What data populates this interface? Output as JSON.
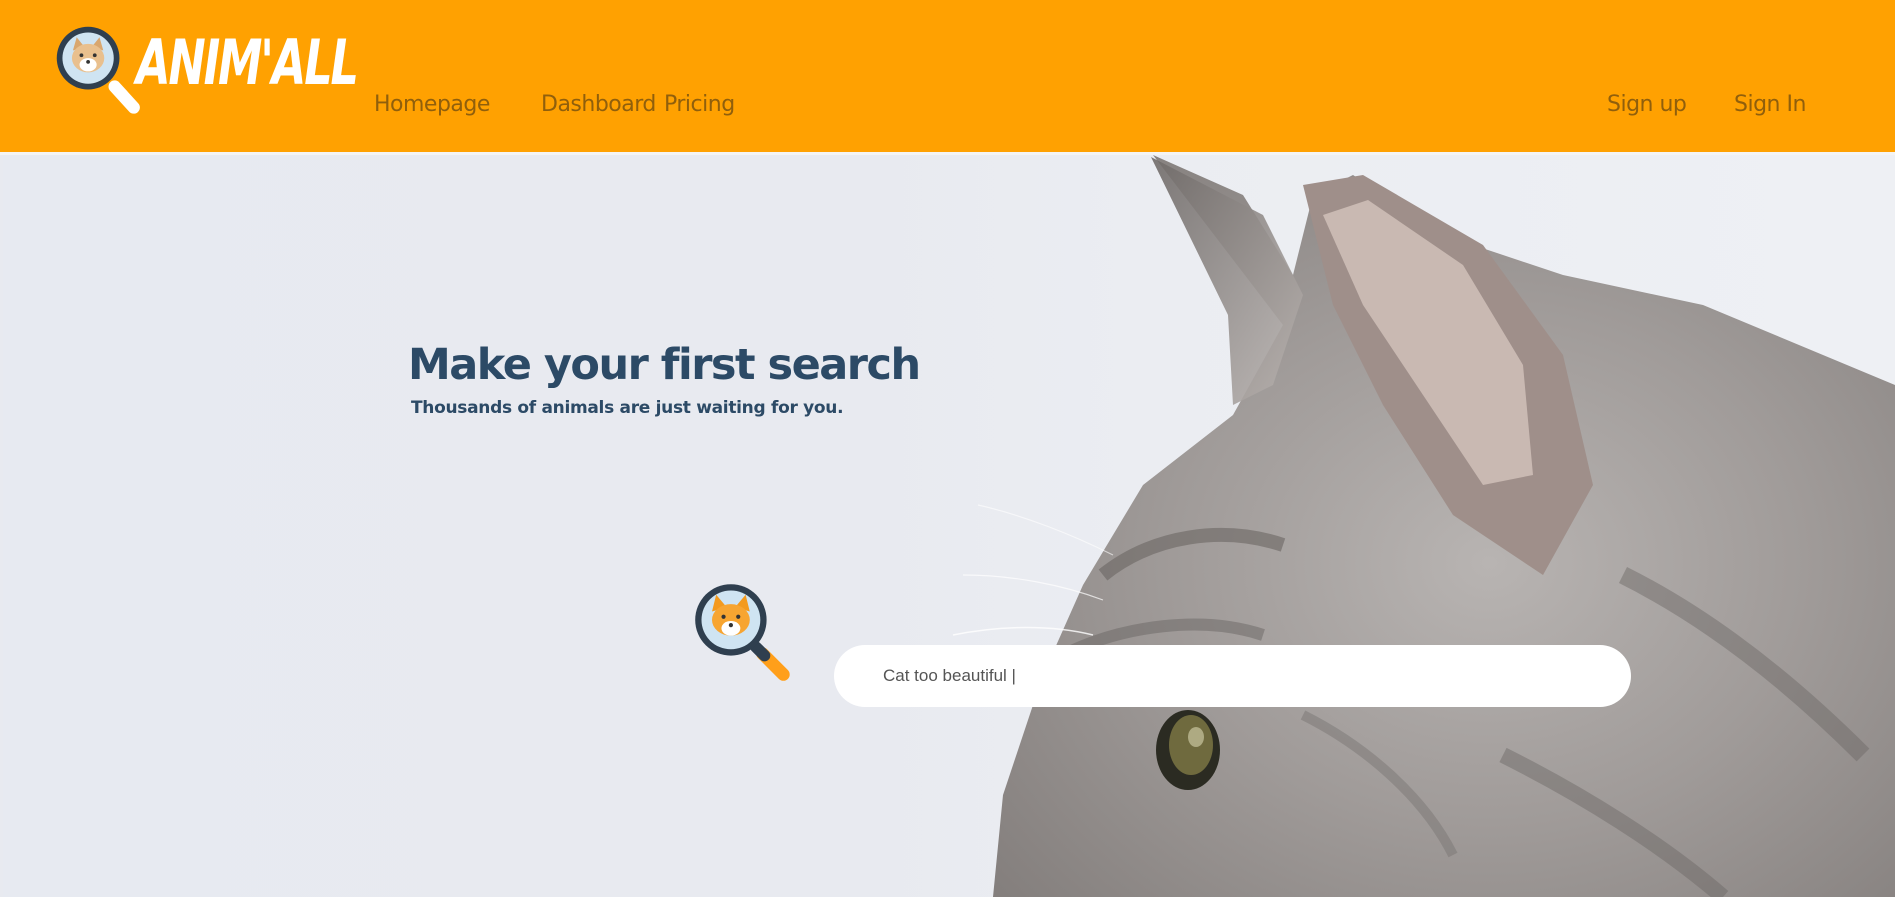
{
  "header": {
    "brand": "ANIM'ALL",
    "background_color": "#ffa101",
    "logo_icon": "magnifier-dog-icon",
    "nav": [
      {
        "label": "Homepage"
      },
      {
        "label": "Dashboard"
      },
      {
        "label": "Pricing"
      }
    ],
    "auth": {
      "signup_label": "Sign up",
      "signin_label": "Sign In"
    }
  },
  "hero": {
    "title": "Make your first search",
    "subtitle": "Thousands of animals are just waiting for you.",
    "search_icon": "magnifier-corgi-icon",
    "search_value": "Cat too beautiful |",
    "title_color": "#2c4a66"
  }
}
